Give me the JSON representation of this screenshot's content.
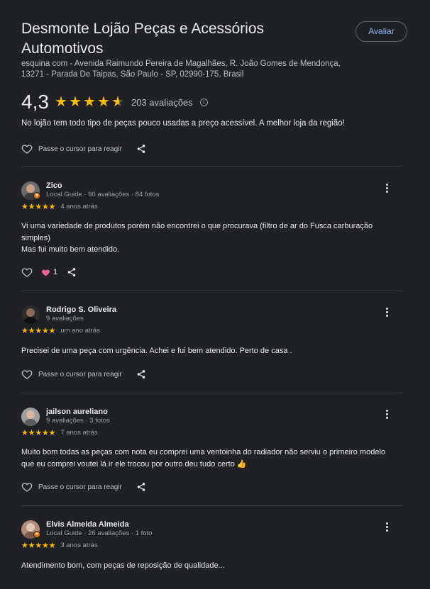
{
  "place": {
    "title": "Desmonte Lojão Peças e Acessórios Automotivos",
    "address": "esquina com - Avenida Raimundo Pereira de Magalhães, R. João Gomes de Mendonça, 13271 - Parada De Taipas, São Paulo - SP, 02990-175, Brasil",
    "rate_button": "Avaliar"
  },
  "summary": {
    "average": "4,3",
    "rating_value": 4.3,
    "count_label": "203 avaliações",
    "info_icon": "info-icon"
  },
  "clipped_review": {
    "text": "No lojão tem todo tipo de peças pouco usadas a preço acessível. A melhor loja da região!",
    "react_label": "Passe o cursor para reagir"
  },
  "reviews": [
    {
      "name": "Zico",
      "meta": "Local Guide · 90 avaliações · 84 fotos",
      "stars": "★★★★★",
      "rating": 5,
      "date": "4 anos atrás",
      "text": "Vi uma variedade de produtos porém não encontrei o que procurava (filtro de ar do Fusca carburação simples)\nMas fui muito bem atendido.",
      "likes": "1",
      "local_guide": true
    },
    {
      "name": "Rodrigo S. Oliveira",
      "meta": "9 avaliações",
      "stars": "★★★★★",
      "rating": 5,
      "date": "um ano atrás",
      "text": "Precisei de uma peça com urgência. Achei e fui bem atendido. Perto de casa .",
      "react_label": "Passe o cursor para reagir",
      "local_guide": false
    },
    {
      "name": "jailson aureliano",
      "meta": "9 avaliações · 3 fotos",
      "stars": "★★★★★",
      "rating": 5,
      "date": "7 anos atrás",
      "text": "Muito bom todas as peças com nota eu comprei uma ventoinha do radiador não serviu o primeiro modelo que eu comprei voutei lá ir ele trocou por outro deu tudo certo 👍",
      "react_label": "Passe o cursor para reagir",
      "local_guide": false
    },
    {
      "name": "Elvis Almeida Almeida",
      "meta": "Local Guide · 26 avaliações · 1 foto",
      "stars": "★★★★★",
      "rating": 5,
      "date": "3 anos atrás",
      "text": "Atendimento bom, com peças de reposição de qualidade...",
      "local_guide": true
    }
  ],
  "colors": {
    "background": "#202124",
    "star": "#fbbc04",
    "link": "#8ab4f8",
    "heart": "#f06292"
  }
}
